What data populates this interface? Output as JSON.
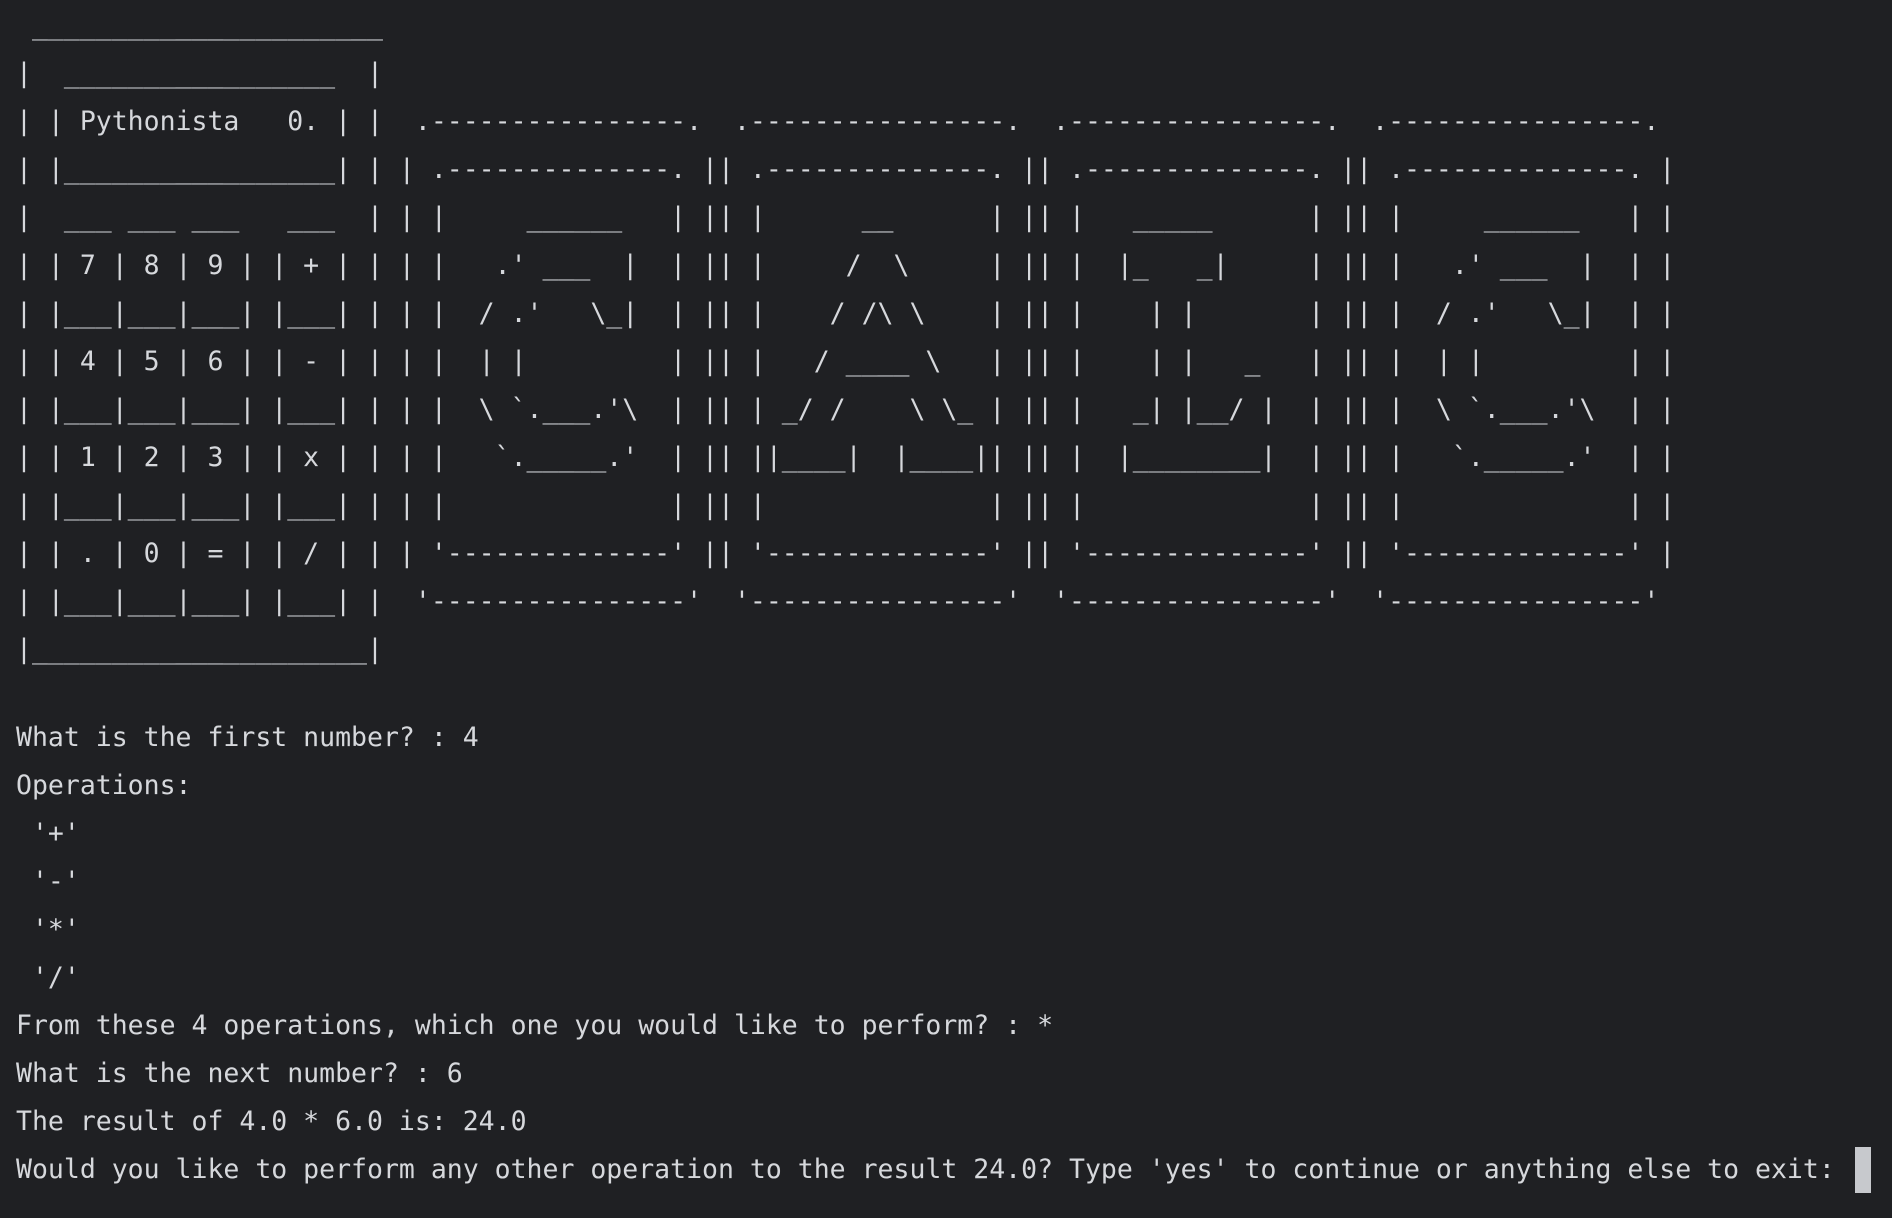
{
  "terminal": {
    "art_lines": [
      " ______________________",
      "|  _________________  |",
      "| | Pythonista   0. | |  .----------------.  .----------------.  .----------------.  .----------------.",
      "| |_________________| | | .--------------. || .--------------. || .--------------. || .--------------. |",
      "|  ___ ___ ___   ___  | | |     ______   | || |      __      | || |   _____      | || |     ______   | |",
      "| | 7 | 8 | 9 | | + | | | |   .' ___  |  | || |     /  \\     | || |  |_   _|     | || |   .' ___  |  | |",
      "| |___|___|___| |___| | | |  / .'   \\_|  | || |    / /\\ \\    | || |    | |       | || |  / .'   \\_|  | |",
      "| | 4 | 5 | 6 | | - | | | |  | |         | || |   / ____ \\   | || |    | |   _   | || |  | |         | |",
      "| |___|___|___| |___| | | |  \\ `.___.'\\  | || | _/ /    \\ \\_ | || |   _| |__/ |  | || |  \\ `.___.'\\  | |",
      "| | 1 | 2 | 3 | | x | | | |   `._____.'  | || ||____|  |____|| || |  |________|  | || |   `._____.'  | |",
      "| |___|___|___| |___| | | |              | || |              | || |              | || |              | |",
      "| | . | 0 | = | | / | | | '--------------' || '--------------' || '--------------' || '--------------' |",
      "| |___|___|___| |___| |  '----------------'  '----------------'  '----------------'  '----------------'",
      "|_____________________|"
    ],
    "io_lines": [
      "What is the first number? : 4",
      "Operations:",
      " '+'",
      " '-'",
      " '*'",
      " '/'",
      "From these 4 operations, which one you would like to perform? : *",
      "What is the next number? : 6",
      "The result of 4.0 * 6.0 is: 24.0"
    ],
    "final_prompt": "Would you like to perform any other operation to the result 24.0? Type 'yes' to continue or anything else to exit: ",
    "colors": {
      "background": "#1f2023",
      "text": "#d6d8dc",
      "cursor": "#c7c9cd"
    }
  }
}
